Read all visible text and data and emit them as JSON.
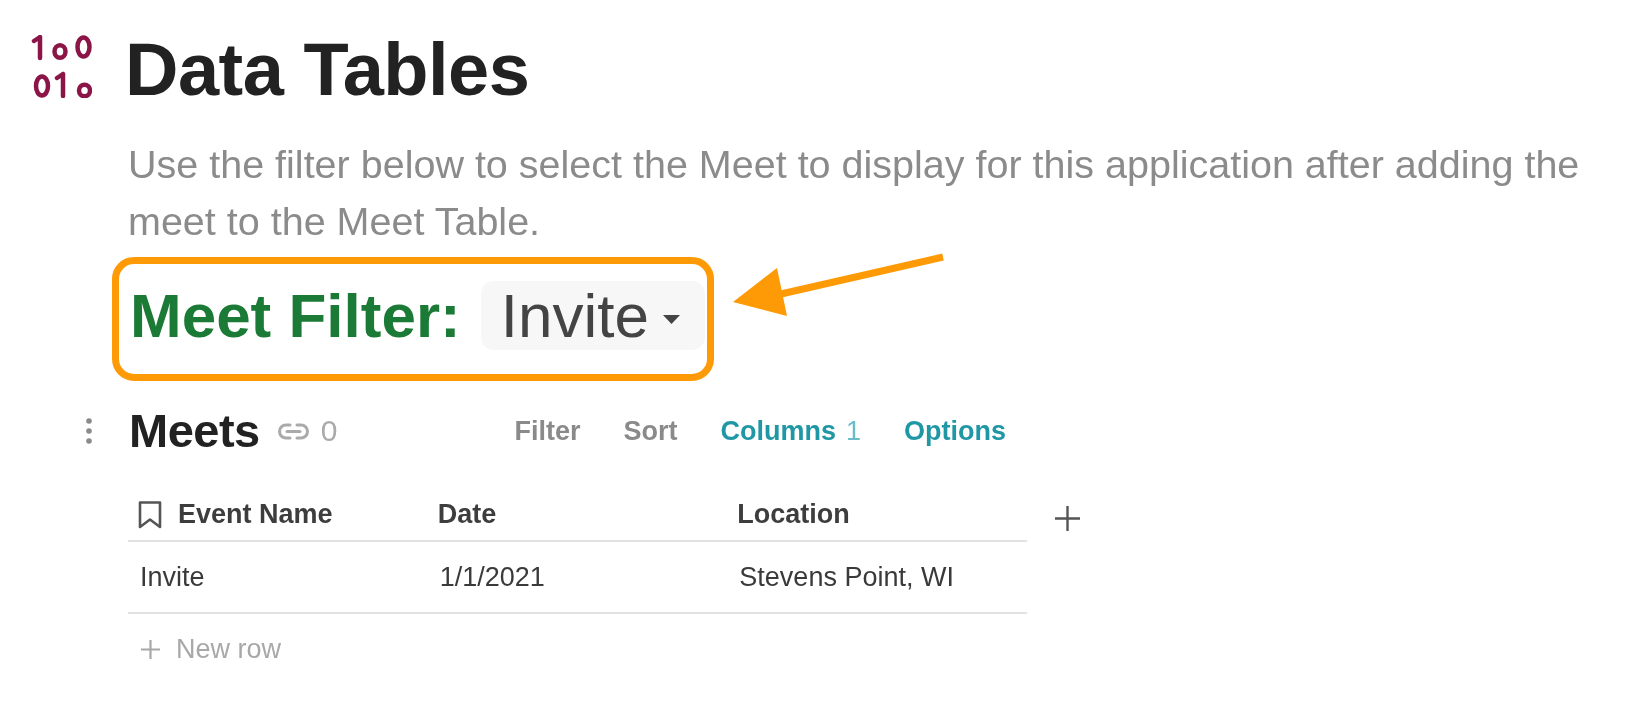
{
  "page": {
    "title": "Data Tables",
    "description": "Use the filter below to select the Meet to display for this application after adding the meet to the Meet Table."
  },
  "meet_filter": {
    "label": "Meet Filter:",
    "value": "Invite"
  },
  "table_view": {
    "title": "Meets",
    "link_count": "0",
    "actions": [
      {
        "label": "Filter",
        "active": false
      },
      {
        "label": "Sort",
        "active": false
      },
      {
        "label": "Columns",
        "active": true,
        "count": "1"
      },
      {
        "label": "Options",
        "active": true
      }
    ]
  },
  "table": {
    "columns": [
      {
        "label": "Event Name",
        "kind": "title"
      },
      {
        "label": "Date",
        "kind": "text"
      },
      {
        "label": "Location",
        "kind": "text"
      }
    ],
    "rows": [
      [
        "Invite",
        "1/1/2021",
        "Stevens Point, WI"
      ]
    ],
    "new_row_label": "New row"
  }
}
